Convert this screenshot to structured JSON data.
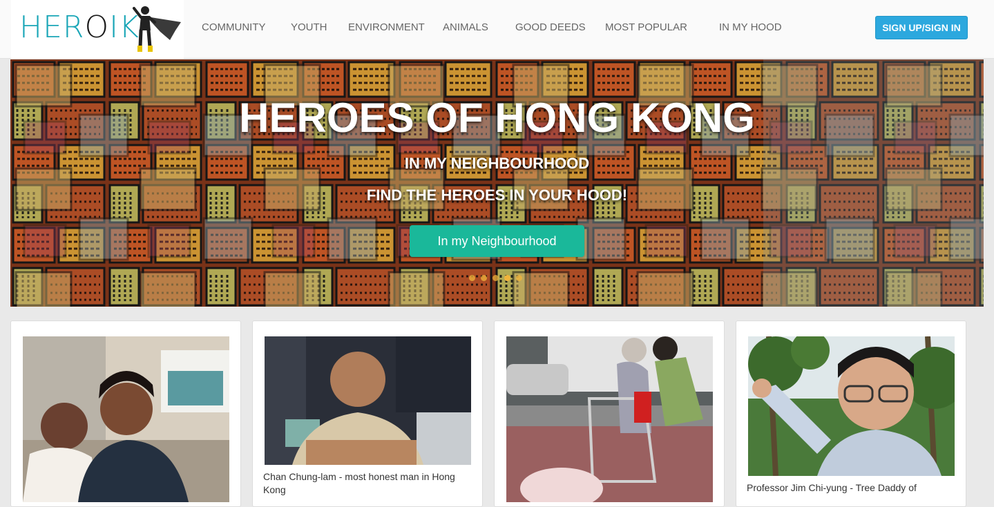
{
  "header": {
    "logo": {
      "part1": "HER",
      "part2": "O",
      "part3": "IK"
    },
    "nav": [
      "COMMUNITY",
      "YOUTH",
      "ENVIRONMENT",
      "ANIMALS",
      "GOOD DEEDS",
      "MOST POPULAR",
      "IN MY HOOD"
    ],
    "signup_label": "SIGN UP/SIGN IN"
  },
  "hero": {
    "title": "HEROES OF HONG KONG",
    "subtitle1": "IN MY NEIGHBOURHOOD",
    "subtitle2": "FIND THE HEROES IN YOUR HOOD!",
    "button_label": "In my Neighbourhood",
    "slide_count": 5,
    "active_slide": 4
  },
  "cards": [
    {
      "caption": ""
    },
    {
      "caption": "Chan Chung-lam - most honest man in Hong Kong"
    },
    {
      "caption": ""
    },
    {
      "caption": "Professor Jim Chi-yung - Tree Daddy of"
    }
  ],
  "colors": {
    "brand_teal": "#1aa6b7",
    "signup_blue": "#2ca8de",
    "hero_button_green": "#1ab89a",
    "carousel_dot": "#f0b43c"
  }
}
